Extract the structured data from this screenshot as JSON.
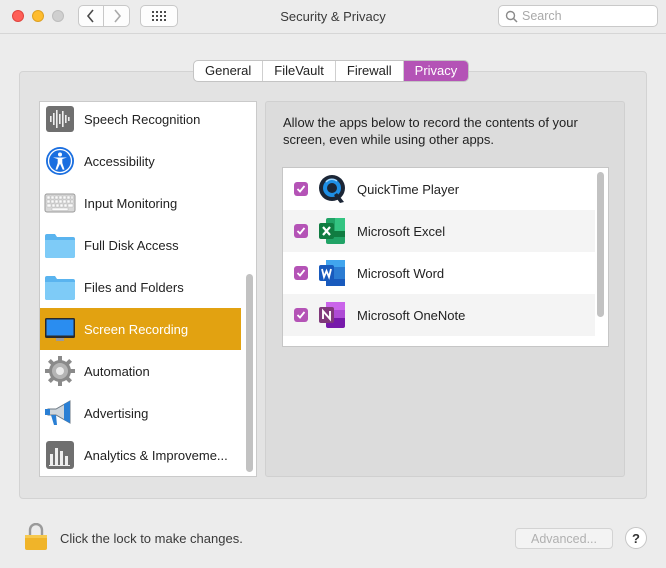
{
  "window": {
    "title": "Security & Privacy"
  },
  "search": {
    "placeholder": "Search"
  },
  "tabs": [
    {
      "label": "General"
    },
    {
      "label": "FileVault"
    },
    {
      "label": "Firewall"
    },
    {
      "label": "Privacy",
      "active": true
    }
  ],
  "sidebar": {
    "items": [
      {
        "label": "Speech Recognition",
        "icon": "waveform-icon"
      },
      {
        "label": "Accessibility",
        "icon": "accessibility-icon"
      },
      {
        "label": "Input Monitoring",
        "icon": "keyboard-icon"
      },
      {
        "label": "Full Disk Access",
        "icon": "folder-icon"
      },
      {
        "label": "Files and Folders",
        "icon": "folder-icon"
      },
      {
        "label": "Screen Recording",
        "icon": "display-icon",
        "selected": true
      },
      {
        "label": "Automation",
        "icon": "gear-icon"
      },
      {
        "label": "Advertising",
        "icon": "megaphone-icon"
      },
      {
        "label": "Analytics & Improveme...",
        "icon": "bar-chart-icon"
      }
    ]
  },
  "main": {
    "description": "Allow the apps below to record the contents of your screen, even while using other apps.",
    "apps": [
      {
        "name": "QuickTime Player",
        "checked": true,
        "icon": "quicktime-icon"
      },
      {
        "name": "Microsoft Excel",
        "checked": true,
        "icon": "excel-icon"
      },
      {
        "name": "Microsoft Word",
        "checked": true,
        "icon": "word-icon"
      },
      {
        "name": "Microsoft OneNote",
        "checked": true,
        "icon": "onenote-icon"
      }
    ]
  },
  "footer": {
    "lock_text": "Click the lock to make changes.",
    "advanced_label": "Advanced...",
    "help_label": "?"
  },
  "colors": {
    "accent": "#b453b6",
    "selection": "#e2a211"
  }
}
